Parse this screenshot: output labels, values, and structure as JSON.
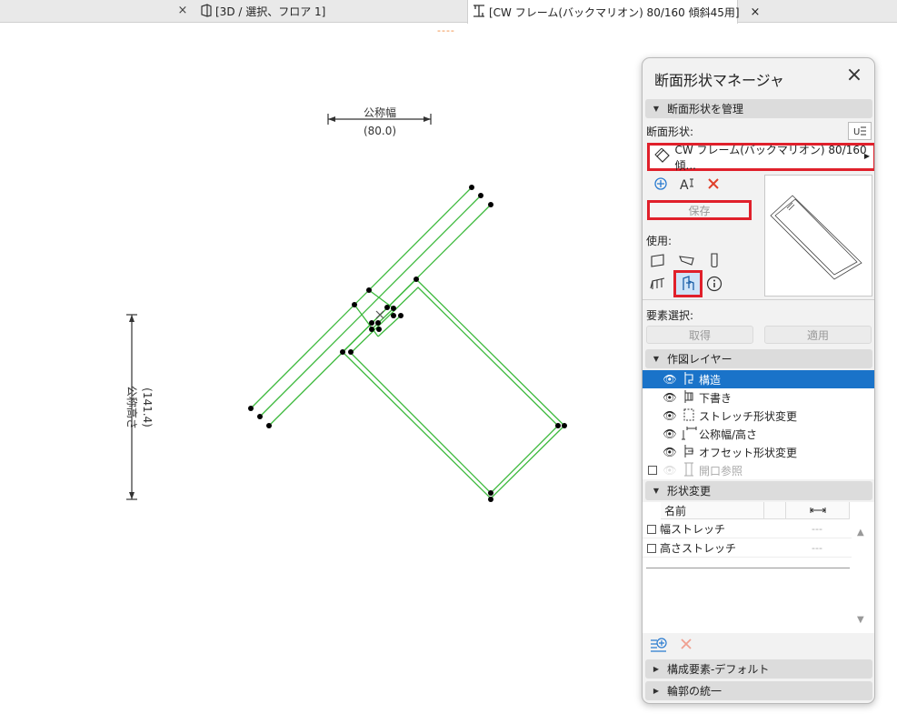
{
  "tabs": [
    {
      "label": "",
      "close": "×"
    },
    {
      "label": "[3D / 選択、フロア 1]"
    },
    {
      "label": "[CW フレーム(バックマリオン) 80/160 傾斜45用]",
      "close": "×"
    }
  ],
  "canvas": {
    "dash_mark": "----",
    "width_dim": {
      "label": "公称幅",
      "value": "(80.0)"
    },
    "height_dim": {
      "label": "公称高さ",
      "value": "(141.4)"
    }
  },
  "panel": {
    "title": "断面形状マネージャ",
    "close": "×",
    "manage_section": "断面形状を管理",
    "profile_label": "断面形状:",
    "profile_name": "CW フレーム(バックマリオン) 80/160 傾...",
    "save_label": "保存",
    "use_label": "使用:",
    "element_select_label": "要素選択:",
    "get_button": "取得",
    "apply_button": "適用",
    "layers_section": "作図レイヤー",
    "layers": [
      {
        "name": "構造",
        "selected": true
      },
      {
        "name": "下書き"
      },
      {
        "name": "ストレッチ形状変更"
      },
      {
        "name": "公称幅/高さ"
      },
      {
        "name": "オフセット形状変更"
      },
      {
        "name": "開口参照",
        "disabled": true
      }
    ],
    "modify_section": "形状変更",
    "grid_header": {
      "name": "名前"
    },
    "grid_rows": [
      {
        "name": "幅ストレッチ",
        "value": "---"
      },
      {
        "name": "高さストレッチ",
        "value": "---"
      }
    ],
    "components_section": "構成要素-デフォルト",
    "contour_section": "輪郭の統一"
  },
  "colors": {
    "accent_red": "#e0202b",
    "selection_blue": "#1a73c9",
    "frame_green": "#3cb93c"
  }
}
